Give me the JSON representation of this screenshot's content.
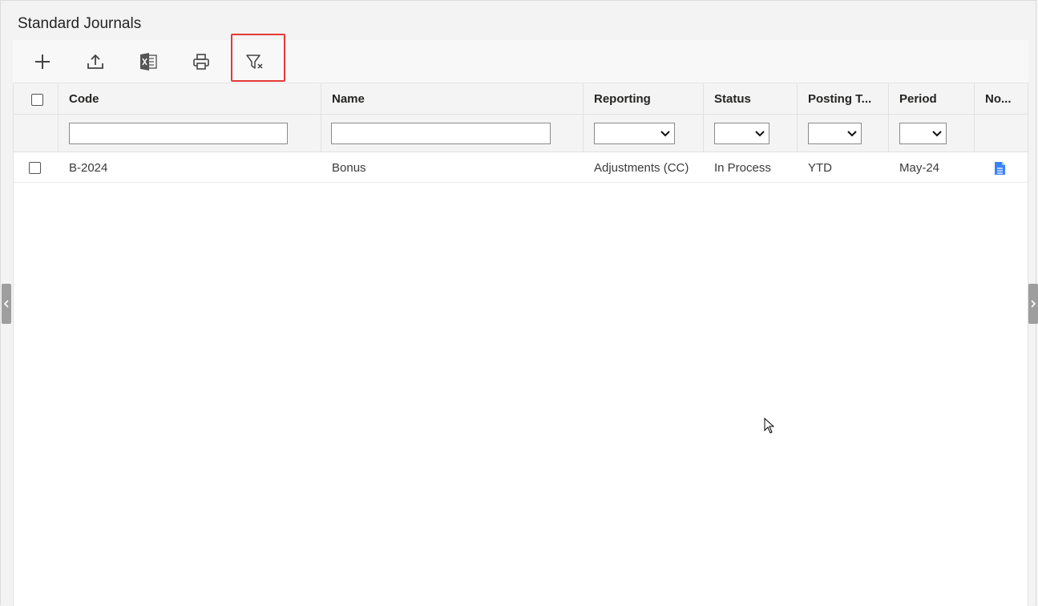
{
  "page": {
    "title": "Standard Journals"
  },
  "toolbar": {
    "buttons": [
      {
        "icon": "plus-icon"
      },
      {
        "icon": "upload-icon"
      },
      {
        "icon": "excel-icon"
      },
      {
        "icon": "print-icon"
      },
      {
        "icon": "clear-filter-icon",
        "highlighted": true
      }
    ]
  },
  "grid": {
    "columns": [
      "Code",
      "Name",
      "Reporting",
      "Status",
      "Posting T...",
      "Period",
      "No..."
    ],
    "rows": [
      {
        "code": "B-2024",
        "name": "Bonus",
        "reporting": "Adjustments (CC)",
        "status": "In Process",
        "posting_type": "YTD",
        "period": "May-24",
        "note_icon": "document-icon"
      }
    ]
  },
  "colors": {
    "highlight": "#e53935",
    "note_icon": "#3b82f6",
    "header_bg": "#f4f4f4"
  }
}
